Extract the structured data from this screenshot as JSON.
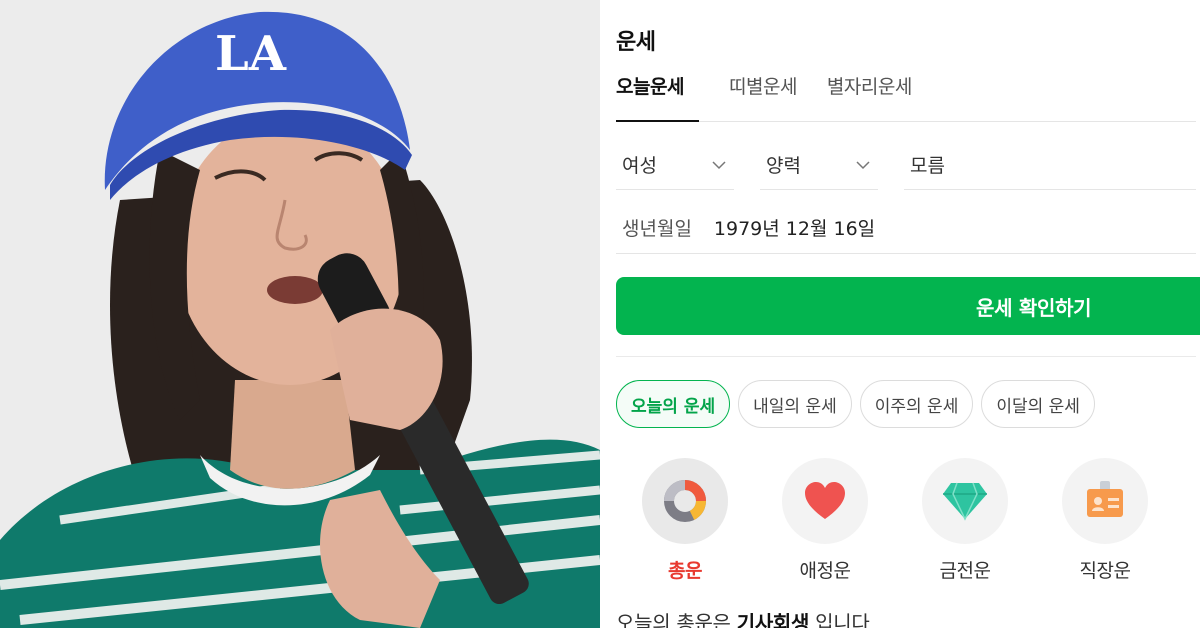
{
  "widget": {
    "title": "운세",
    "tabs": [
      {
        "label": "오늘운세",
        "active": true
      },
      {
        "label": "띠별운세",
        "active": false
      },
      {
        "label": "별자리운세",
        "active": false
      }
    ],
    "gender": {
      "value": "여성"
    },
    "calendar": {
      "value": "양력"
    },
    "birth_time": {
      "value": "모름"
    },
    "birthdate": {
      "label": "생년월일",
      "value": "1979년 12월 16일"
    },
    "cta_label": "운세 확인하기",
    "period_pills": [
      {
        "label": "오늘의 운세",
        "active": true
      },
      {
        "label": "내일의 운세",
        "active": false
      },
      {
        "label": "이주의 운세",
        "active": false
      },
      {
        "label": "이달의 운세",
        "active": false
      }
    ],
    "categories": [
      {
        "label": "총운",
        "icon": "donut-chart-icon",
        "active": true
      },
      {
        "label": "애정운",
        "icon": "heart-icon",
        "active": false
      },
      {
        "label": "금전운",
        "icon": "diamond-icon",
        "active": false
      },
      {
        "label": "직장운",
        "icon": "id-badge-icon",
        "active": false
      }
    ],
    "result": {
      "prefix": "오늘의 총운은 ",
      "keyword": "기사회생",
      "suffix": " 입니다"
    }
  },
  "photo": {
    "cap_text": "LA"
  },
  "colors": {
    "accent_green": "#03b44f",
    "active_red": "#e8392f",
    "heart": "#ef5350",
    "diamond": "#2ec4a0",
    "badge": "#f79a4c"
  }
}
